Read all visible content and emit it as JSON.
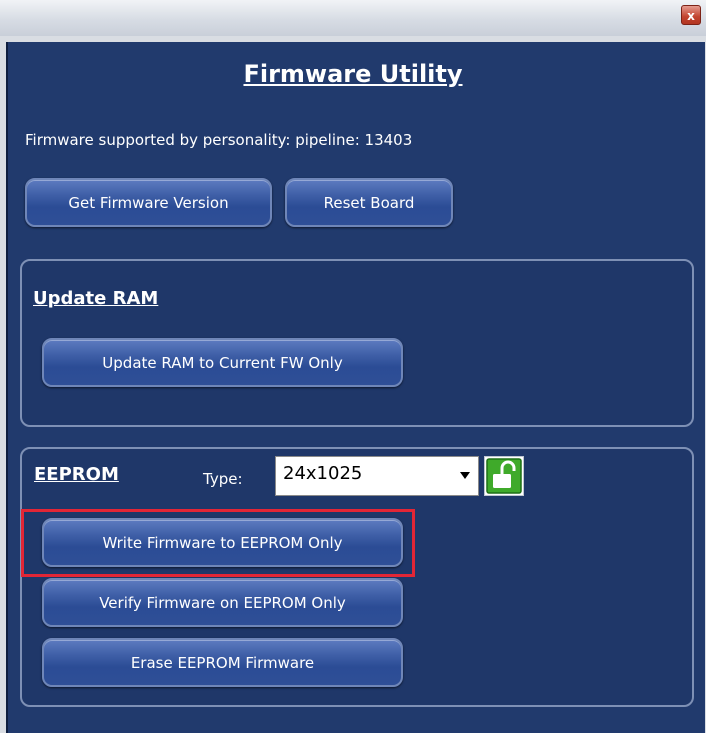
{
  "window": {
    "close_glyph": "x"
  },
  "title": "Firmware Utility",
  "info_text": "Firmware supported by personality:  pipeline: 13403",
  "buttons": {
    "get_firmware_version": "Get Firmware Version",
    "reset_board": "Reset Board"
  },
  "update_ram": {
    "title": "Update RAM",
    "button": "Update RAM to Current FW Only"
  },
  "eeprom": {
    "title": "EEPROM",
    "type_label": "Type:",
    "type_value": "24x1025",
    "write_button": "Write Firmware to EEPROM Only",
    "verify_button": "Verify Firmware on EEPROM Only",
    "erase_button": "Erase EEPROM Firmware"
  },
  "icons": {
    "close": "close-icon",
    "lock": "lock-open-icon",
    "dropdown": "chevron-down-icon"
  },
  "colors": {
    "panel_background": "#213a6d",
    "button_gradient_top": "#5d7bc0",
    "button_gradient_bottom": "#2b4c95",
    "highlight": "#e22636",
    "lock_green": "#3faa2a"
  }
}
